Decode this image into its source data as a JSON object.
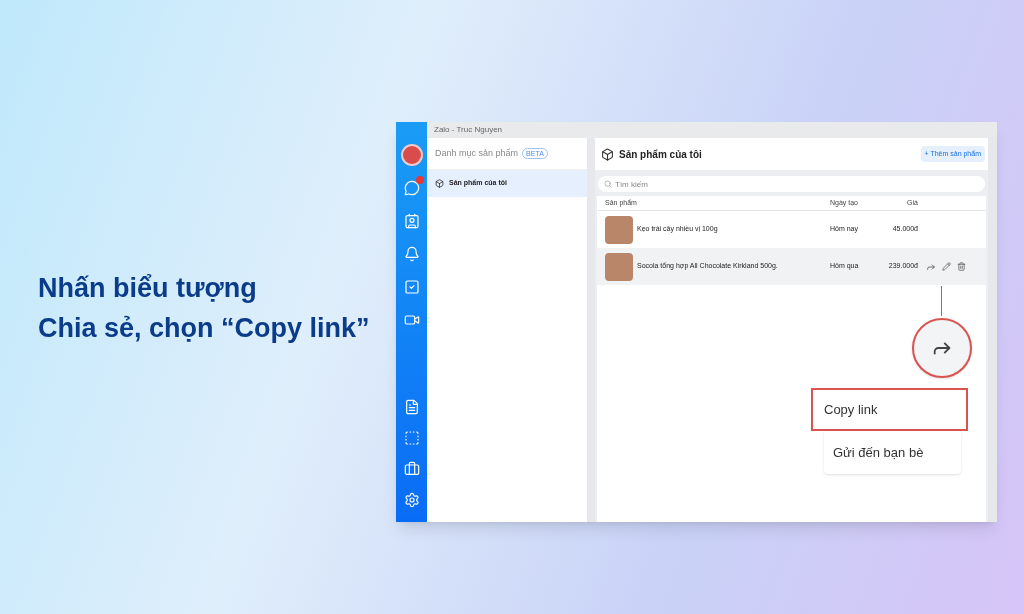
{
  "caption": {
    "lines": [
      "Nhấn biểu tượng",
      "Chia sẻ, chọn “Copy link”"
    ]
  },
  "window": {
    "title": "Zalo - Truc Nguyen"
  },
  "sidebar": {
    "items": [
      {
        "kind": "chat",
        "badge": true
      },
      {
        "kind": "contacts",
        "badge": false
      },
      {
        "kind": "bell",
        "badge": false
      },
      {
        "kind": "todo",
        "badge": false
      },
      {
        "kind": "video",
        "badge": false
      }
    ],
    "bottom_items": [
      {
        "kind": "file"
      },
      {
        "kind": "capture"
      },
      {
        "kind": "briefcase"
      },
      {
        "kind": "settings"
      }
    ]
  },
  "catalog": {
    "title": "Danh mục sản phẩm",
    "badge": "BETA",
    "items": [
      {
        "label": "Sản phẩm của tôi",
        "selected": true
      }
    ]
  },
  "main": {
    "title": "Sản phẩm của tôi",
    "add_button": "+ Thêm sản phẩm",
    "search": {
      "placeholder": "Tìm kiếm"
    },
    "columns": [
      "Sản phẩm",
      "Ngày tạo",
      "Giá"
    ],
    "rows": [
      {
        "product": "Kẹo trái cây nhiều vị 100g",
        "date": "Hôm nay",
        "price": "45.000đ",
        "hovered": false
      },
      {
        "product": "Socola tổng hợp All Chocolate Kirkland 500g.",
        "date": "Hôm qua",
        "price": "239.000đ",
        "hovered": true
      }
    ]
  },
  "share_menu": {
    "items": [
      {
        "label": "Copy link",
        "selected": true
      },
      {
        "label": "Gửi đến bạn bè",
        "selected": false
      }
    ]
  }
}
